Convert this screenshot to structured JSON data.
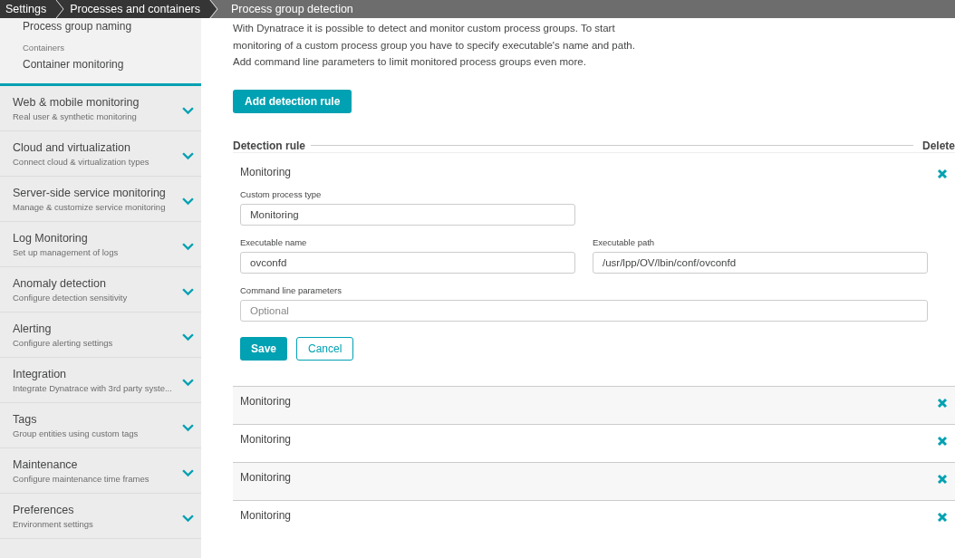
{
  "breadcrumbs": [
    {
      "label": "Settings",
      "selected": false
    },
    {
      "label": "Processes and containers",
      "selected": false
    },
    {
      "label": "Process group detection",
      "selected": true
    }
  ],
  "sidebar": {
    "top_items": [
      {
        "kind": "link",
        "label": "Process group naming"
      },
      {
        "kind": "group",
        "label": "Containers"
      },
      {
        "kind": "link",
        "label": "Container monitoring"
      }
    ],
    "sections": [
      {
        "title": "Web & mobile monitoring",
        "subtitle": "Real user & synthetic monitoring",
        "expanded": false
      },
      {
        "title": "Cloud and virtualization",
        "subtitle": "Connect cloud & virtualization types",
        "expanded": false
      },
      {
        "title": "Server-side service monitoring",
        "subtitle": "Manage & customize service monitoring",
        "expanded": false
      },
      {
        "title": "Log Monitoring",
        "subtitle": "Set up management of logs",
        "expanded": false
      },
      {
        "title": "Anomaly detection",
        "subtitle": "Configure detection sensitivity",
        "expanded": false
      },
      {
        "title": "Alerting",
        "subtitle": "Configure alerting settings",
        "expanded": false
      },
      {
        "title": "Integration",
        "subtitle": "Integrate Dynatrace with 3rd party syste...",
        "expanded": false
      },
      {
        "title": "Tags",
        "subtitle": "Group entities using custom tags",
        "expanded": false
      },
      {
        "title": "Maintenance",
        "subtitle": "Configure maintenance time frames",
        "expanded": false
      },
      {
        "title": "Preferences",
        "subtitle": "Environment settings",
        "expanded": false
      }
    ]
  },
  "description": "With Dynatrace it is possible to detect and monitor custom process groups. To start monitoring of a custom process group you have to specify executable's name and path. Add command line parameters to limit monitored process groups even more.",
  "add_button": "Add detection rule",
  "table": {
    "columns": [
      "Detection rule",
      "Delete"
    ],
    "rows": [
      {
        "name": "Monitoring",
        "expanded": true
      },
      {
        "name": "Monitoring",
        "expanded": false
      },
      {
        "name": "Monitoring",
        "expanded": false
      },
      {
        "name": "Monitoring",
        "expanded": false
      },
      {
        "name": "Monitoring",
        "expanded": false
      }
    ]
  },
  "form": {
    "rows": [
      [
        {
          "label": "Custom process type",
          "value": "Monitoring"
        }
      ],
      [
        {
          "label": "Executable name",
          "value": "ovconfd"
        },
        {
          "label": "Executable path",
          "value": "/usr/lpp/OV/lbin/conf/ovconfd"
        }
      ],
      [
        {
          "label": "Command line parameters",
          "placeholder": "Optional"
        }
      ]
    ],
    "buttons": [
      {
        "kind": "primary",
        "label": "Save"
      },
      {
        "kind": "secondary",
        "label": "Cancel"
      }
    ]
  }
}
